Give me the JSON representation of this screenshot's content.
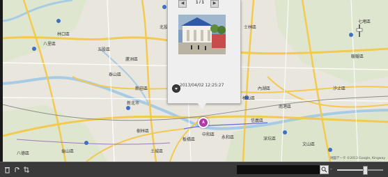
{
  "map": {
    "place_labels": [
      {
        "key": "linkou",
        "text": "林口區"
      },
      {
        "key": "bali",
        "text": "八里區"
      },
      {
        "key": "wugu",
        "text": "五股區"
      },
      {
        "key": "luzhou",
        "text": "蘆洲區"
      },
      {
        "key": "taishan",
        "text": "泰山區"
      },
      {
        "key": "xinzhuang",
        "text": "新莊區"
      },
      {
        "key": "xinbei",
        "text": "新北市"
      },
      {
        "key": "guishan",
        "text": "龜山區"
      },
      {
        "key": "shulin",
        "text": "樹林區"
      },
      {
        "key": "tucheng",
        "text": "土城區"
      },
      {
        "key": "banqiao",
        "text": "板橋區"
      },
      {
        "key": "zhonghe",
        "text": "中和區"
      },
      {
        "key": "yonghe",
        "text": "永和區"
      },
      {
        "key": "neihu",
        "text": "內湖區"
      },
      {
        "key": "songshan",
        "text": "松山區"
      },
      {
        "key": "xinyi",
        "text": "信義區"
      },
      {
        "key": "nangang",
        "text": "南港區"
      },
      {
        "key": "shenkeng",
        "text": "深坑區"
      },
      {
        "key": "xizhi",
        "text": "汐止區"
      },
      {
        "key": "qidu",
        "text": "七堵區"
      },
      {
        "key": "nuannuan",
        "text": "暖暖區"
      },
      {
        "key": "bade",
        "text": "八德區"
      },
      {
        "key": "shilin",
        "text": "士林區"
      },
      {
        "key": "beitou",
        "text": "北投區"
      },
      {
        "key": "wenshan",
        "text": "文山區"
      }
    ],
    "copyright": "地図データ ©2013 Google, Kingway",
    "marker_label": "A"
  },
  "popup": {
    "page_counter": "1 / 1",
    "prev_icon": "prev-arrow-icon",
    "next_icon": "next-arrow-icon",
    "timestamp": "2013/04/02 12:25:27",
    "action_icon": "circle-down-arrow-icon"
  },
  "toolbar": {
    "icons": [
      "trash-icon",
      "rotate-icon",
      "crop-icon"
    ],
    "search_value": "",
    "search_placeholder": "",
    "search_icon": "magnifier-icon",
    "zoom_minus": "-",
    "zoom_level": 0.6
  },
  "colors": {
    "marker": "#b13ba9",
    "bar": "#3a3a3a",
    "highway": "#f3c94f",
    "water": "#a7cbe5",
    "land": "#e9e5dc"
  }
}
